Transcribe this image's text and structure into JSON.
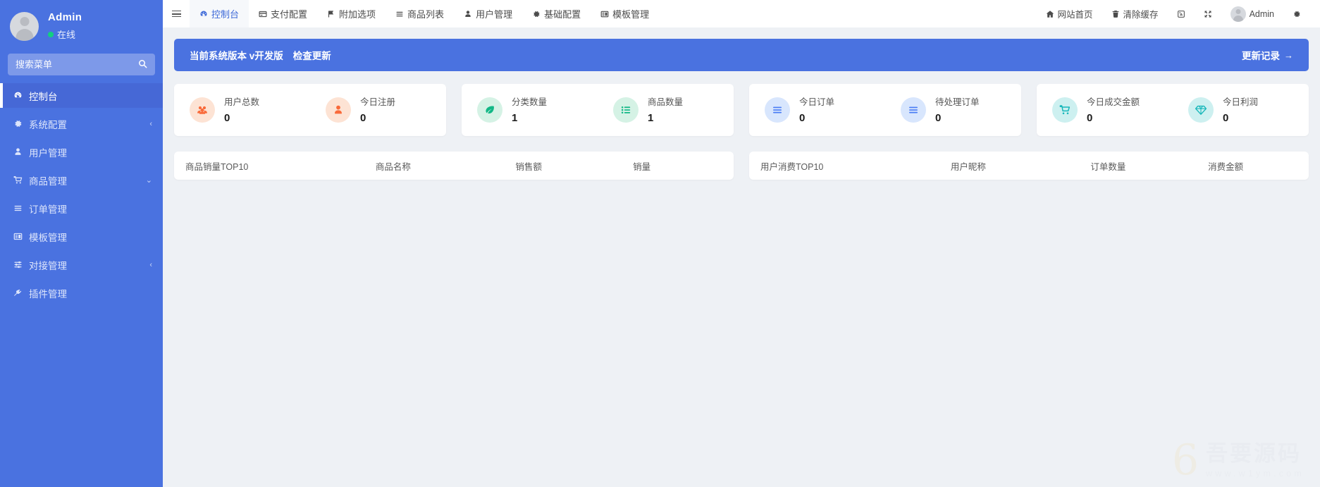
{
  "colors": {
    "sidebar_bg": "#4a72e0",
    "accent": "#3f6ad8",
    "banner_bg": "#4a72e0",
    "content_bg": "#eef1f5",
    "online_green": "#12d07f",
    "orange": "#f96a3a",
    "orange_soft": "#fde3d4",
    "green": "#12b886",
    "green_soft": "#d5f2e5",
    "blue": "#4a7df5",
    "blue_soft": "#d8e6fd",
    "teal": "#17b7ba",
    "teal_soft": "#cdf0f0"
  },
  "sidebar": {
    "profile": {
      "name": "Admin",
      "status": "在线",
      "avatar_icon": "user-avatar"
    },
    "search": {
      "placeholder": "搜索菜单",
      "value": "",
      "icon": "search-icon"
    },
    "items": [
      {
        "label": "控制台",
        "icon": "dashboard-icon",
        "active": true,
        "chevron": ""
      },
      {
        "label": "系统配置",
        "icon": "gear-icon",
        "active": false,
        "chevron": "‹"
      },
      {
        "label": "用户管理",
        "icon": "user-icon",
        "active": false,
        "chevron": ""
      },
      {
        "label": "商品管理",
        "icon": "cart-icon",
        "active": false,
        "chevron": "⌄"
      },
      {
        "label": "订单管理",
        "icon": "list-icon",
        "active": false,
        "chevron": ""
      },
      {
        "label": "模板管理",
        "icon": "template-icon",
        "active": false,
        "chevron": ""
      },
      {
        "label": "对接管理",
        "icon": "sliders-icon",
        "active": false,
        "chevron": "‹"
      },
      {
        "label": "插件管理",
        "icon": "plug-icon",
        "active": false,
        "chevron": ""
      }
    ]
  },
  "topbar": {
    "menu_toggle_icon": "hamburger-icon",
    "tabs": [
      {
        "label": "控制台",
        "icon": "dashboard-icon",
        "active": true
      },
      {
        "label": "支付配置",
        "icon": "payment-icon",
        "active": false
      },
      {
        "label": "附加选项",
        "icon": "flag-icon",
        "active": false
      },
      {
        "label": "商品列表",
        "icon": "list-icon",
        "active": false
      },
      {
        "label": "用户管理",
        "icon": "user-icon",
        "active": false
      },
      {
        "label": "基础配置",
        "icon": "gear-icon",
        "active": false
      },
      {
        "label": "模板管理",
        "icon": "template-icon",
        "active": false
      }
    ],
    "right": [
      {
        "label": "网站首页",
        "icon": "home-icon"
      },
      {
        "label": "清除缓存",
        "icon": "trash-icon"
      },
      {
        "label": "",
        "icon": "theme-icon"
      },
      {
        "label": "",
        "icon": "fullscreen-icon"
      },
      {
        "label": "Admin",
        "icon": "user-avatar"
      },
      {
        "label": "",
        "icon": "settings-gear-icon"
      }
    ]
  },
  "banner": {
    "text": "当前系统版本 v开发版",
    "check_update_label": "检查更新",
    "changelog_label": "更新记录",
    "arrow": "→"
  },
  "stat_cards": [
    {
      "items": [
        {
          "label": "用户总数",
          "value": "0",
          "icon": "users-group-icon",
          "color": "#f96a3a",
          "bg": "#fde3d4"
        },
        {
          "label": "今日注册",
          "value": "0",
          "icon": "user-solid-icon",
          "color": "#f96a3a",
          "bg": "#fde3d4"
        }
      ]
    },
    {
      "items": [
        {
          "label": "分类数量",
          "value": "1",
          "icon": "leaf-icon",
          "color": "#12b886",
          "bg": "#d5f2e5"
        },
        {
          "label": "商品数量",
          "value": "1",
          "icon": "task-list-icon",
          "color": "#12b886",
          "bg": "#d5f2e5"
        }
      ]
    },
    {
      "items": [
        {
          "label": "今日订单",
          "value": "0",
          "icon": "bars-icon",
          "color": "#4a7df5",
          "bg": "#d8e6fd"
        },
        {
          "label": "待处理订单",
          "value": "0",
          "icon": "bars-icon",
          "color": "#4a7df5",
          "bg": "#d8e6fd"
        }
      ]
    },
    {
      "items": [
        {
          "label": "今日成交金额",
          "value": "0",
          "icon": "cart-icon",
          "color": "#17b7ba",
          "bg": "#cdf0f0"
        },
        {
          "label": "今日利润",
          "value": "0",
          "icon": "diamond-icon",
          "color": "#17b7ba",
          "bg": "#cdf0f0"
        }
      ]
    }
  ],
  "tables": [
    {
      "title": "商品销量TOP10",
      "columns": [
        "商品名称",
        "销售额",
        "销量"
      ],
      "rows": []
    },
    {
      "title": "用户消费TOP10",
      "columns": [
        "用户昵称",
        "订单数量",
        "消费金额"
      ],
      "rows": []
    }
  ],
  "watermark": {
    "logo": "6",
    "title": "吾要源码",
    "url": "www.w1ym.com"
  }
}
